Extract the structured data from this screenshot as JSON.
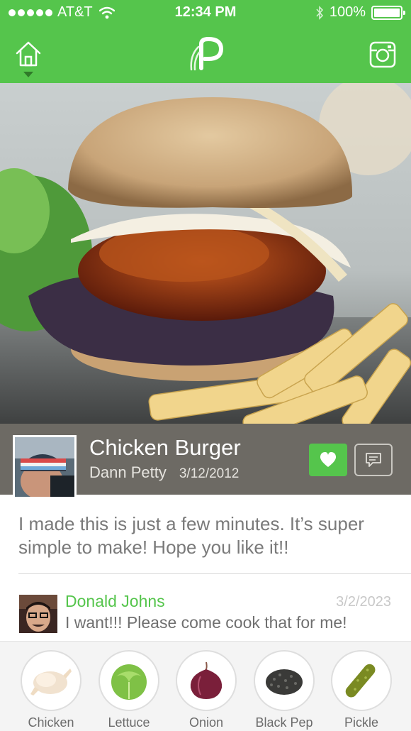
{
  "status_bar": {
    "carrier": "AT&T",
    "time": "12:34 PM",
    "battery": "100%"
  },
  "nav": {
    "home_icon": "home-icon",
    "logo_icon": "p-leaf-logo",
    "camera_icon": "instagram-camera-icon"
  },
  "post": {
    "title": "Chicken Burger",
    "author": "Dann Petty",
    "date": "3/12/2012",
    "description": "I made this is just a few minutes. It’s super simple to make! Hope you like it!!",
    "like_icon": "heart-icon",
    "comment_icon": "speech-bubble-icon"
  },
  "comments": [
    {
      "author": "Donald Johns",
      "date": "3/2/2023",
      "text": "I want!!! Please come cook that for me!"
    }
  ],
  "ingredients": [
    {
      "label": "Chicken"
    },
    {
      "label": "Lettuce"
    },
    {
      "label": "Onion"
    },
    {
      "label": "Black Pep"
    },
    {
      "label": "Pickle"
    }
  ],
  "colors": {
    "accent": "#55c54c",
    "title_bar": "#6d6a64",
    "text_body": "#7a7a7a"
  }
}
